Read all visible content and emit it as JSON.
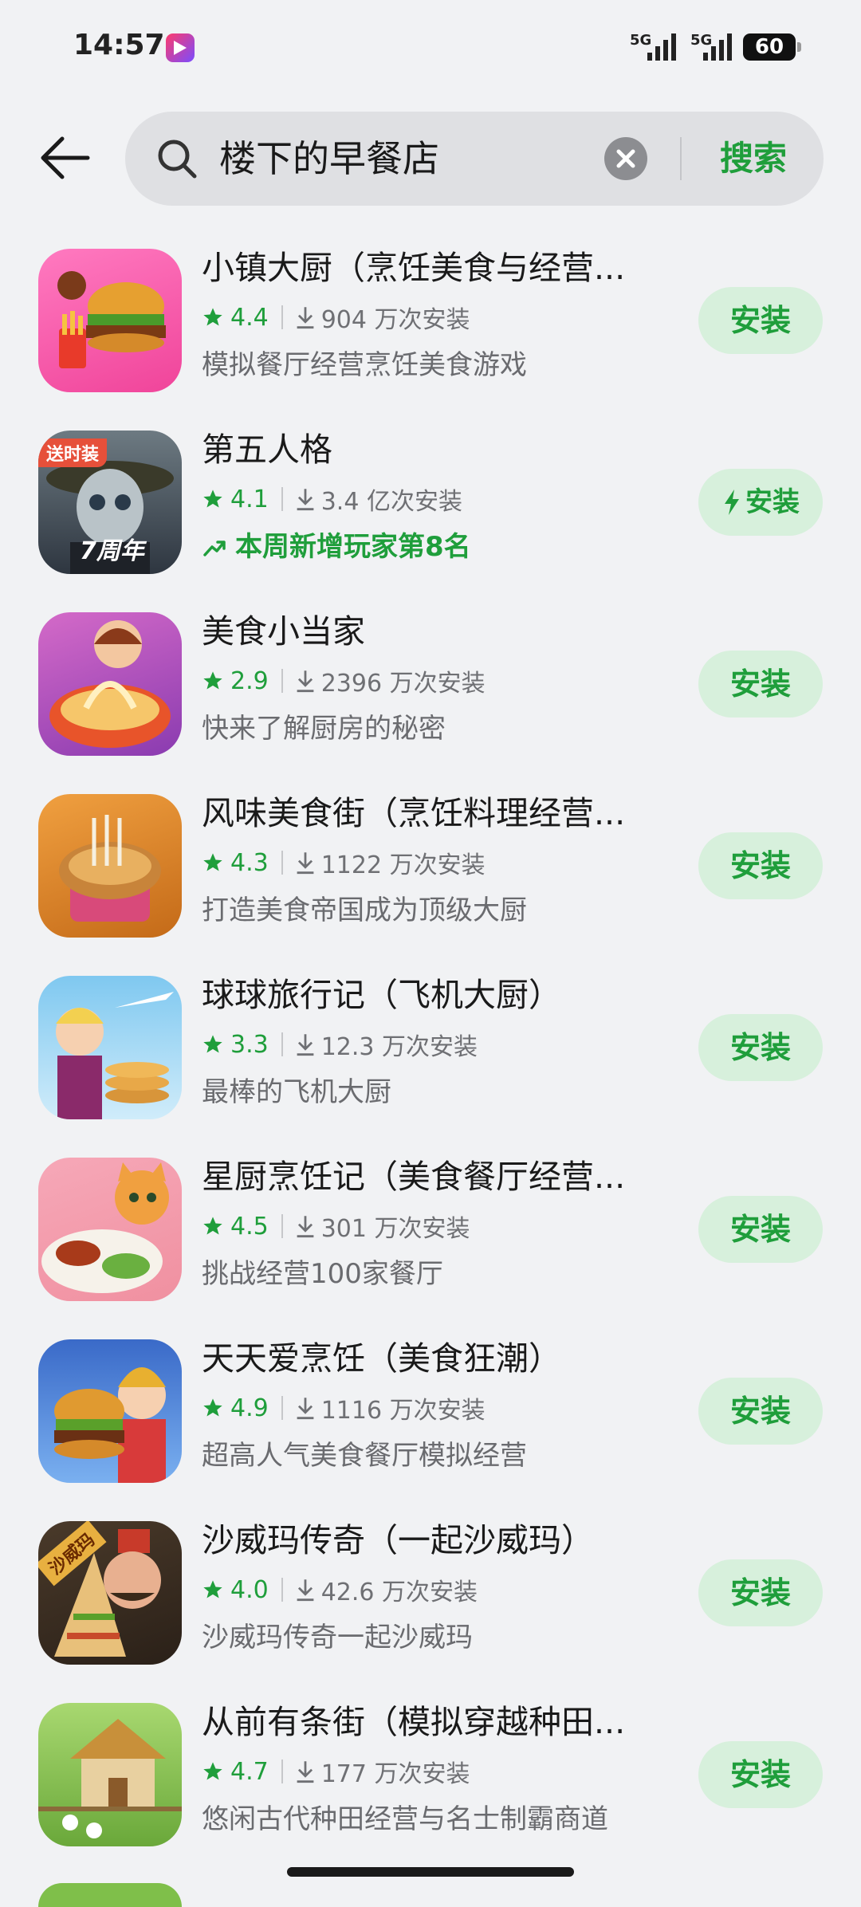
{
  "status_bar": {
    "time": "14:57",
    "network1": "5G",
    "network2": "5G",
    "battery": "60"
  },
  "search": {
    "query": "楼下的早餐店",
    "search_label": "搜索"
  },
  "colors": {
    "accent_green": "#1f9e3b",
    "install_bg": "#d7f0dc",
    "background": "#f1f2f4"
  },
  "apps": [
    {
      "name": "小镇大厨（烹饪美食与经营...",
      "rating": "4.4",
      "downloads": "904 万次安装",
      "desc": "模拟餐厅经营烹饪美食游戏",
      "install": "安装"
    },
    {
      "name": "第五人格",
      "rating": "4.1",
      "downloads": "3.4 亿次安装",
      "desc": "本周新增玩家第8名",
      "install": "安装",
      "icon_badge": "送时装",
      "icon_caption": "7周年"
    },
    {
      "name": "美食小当家",
      "rating": "2.9",
      "downloads": "2396 万次安装",
      "desc": "快来了解厨房的秘密",
      "install": "安装"
    },
    {
      "name": "风味美食街（烹饪料理经营...",
      "rating": "4.3",
      "downloads": "1122 万次安装",
      "desc": "打造美食帝国成为顶级大厨",
      "install": "安装"
    },
    {
      "name": "球球旅行记（飞机大厨）",
      "rating": "3.3",
      "downloads": "12.3 万次安装",
      "desc": "最棒的飞机大厨",
      "install": "安装"
    },
    {
      "name": "星厨烹饪记（美食餐厅经营...",
      "rating": "4.5",
      "downloads": "301 万次安装",
      "desc": "挑战经营100家餐厅",
      "install": "安装"
    },
    {
      "name": "天天爱烹饪（美食狂潮）",
      "rating": "4.9",
      "downloads": "1116 万次安装",
      "desc": "超高人气美食餐厅模拟经营",
      "install": "安装"
    },
    {
      "name": "沙威玛传奇（一起沙威玛）",
      "rating": "4.0",
      "downloads": "42.6 万次安装",
      "desc": "沙威玛传奇一起沙威玛",
      "install": "安装",
      "icon_badge": "沙威玛"
    },
    {
      "name": "从前有条街（模拟穿越种田...",
      "rating": "4.7",
      "downloads": "177 万次安装",
      "desc": "悠闲古代种田经营与名士制霸商道",
      "install": "安装"
    }
  ]
}
